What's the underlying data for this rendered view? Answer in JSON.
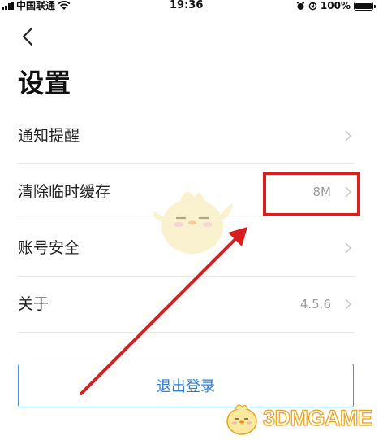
{
  "status_bar": {
    "carrier": "中国联通",
    "time": "19:36",
    "battery": "100%"
  },
  "header": {
    "back_icon": "chevron-left-icon",
    "title": "设置"
  },
  "settings": {
    "items": [
      {
        "label": "通知提醒",
        "value": "",
        "icon": "chevron-right-icon"
      },
      {
        "label": "清除临时缓存",
        "value": "8M",
        "icon": "chevron-right-icon"
      },
      {
        "label": "账号安全",
        "value": "",
        "icon": "chevron-right-icon"
      },
      {
        "label": "关于",
        "value": "4.5.6",
        "icon": "chevron-right-icon"
      }
    ]
  },
  "logout": {
    "label": "退出登录"
  },
  "watermark": {
    "brand": "3DMGAME"
  },
  "colors": {
    "accent": "#2f7fd8",
    "annotation": "#d81e1e",
    "divider": "#e6e6e6",
    "muted_text": "#9a9a9a"
  }
}
